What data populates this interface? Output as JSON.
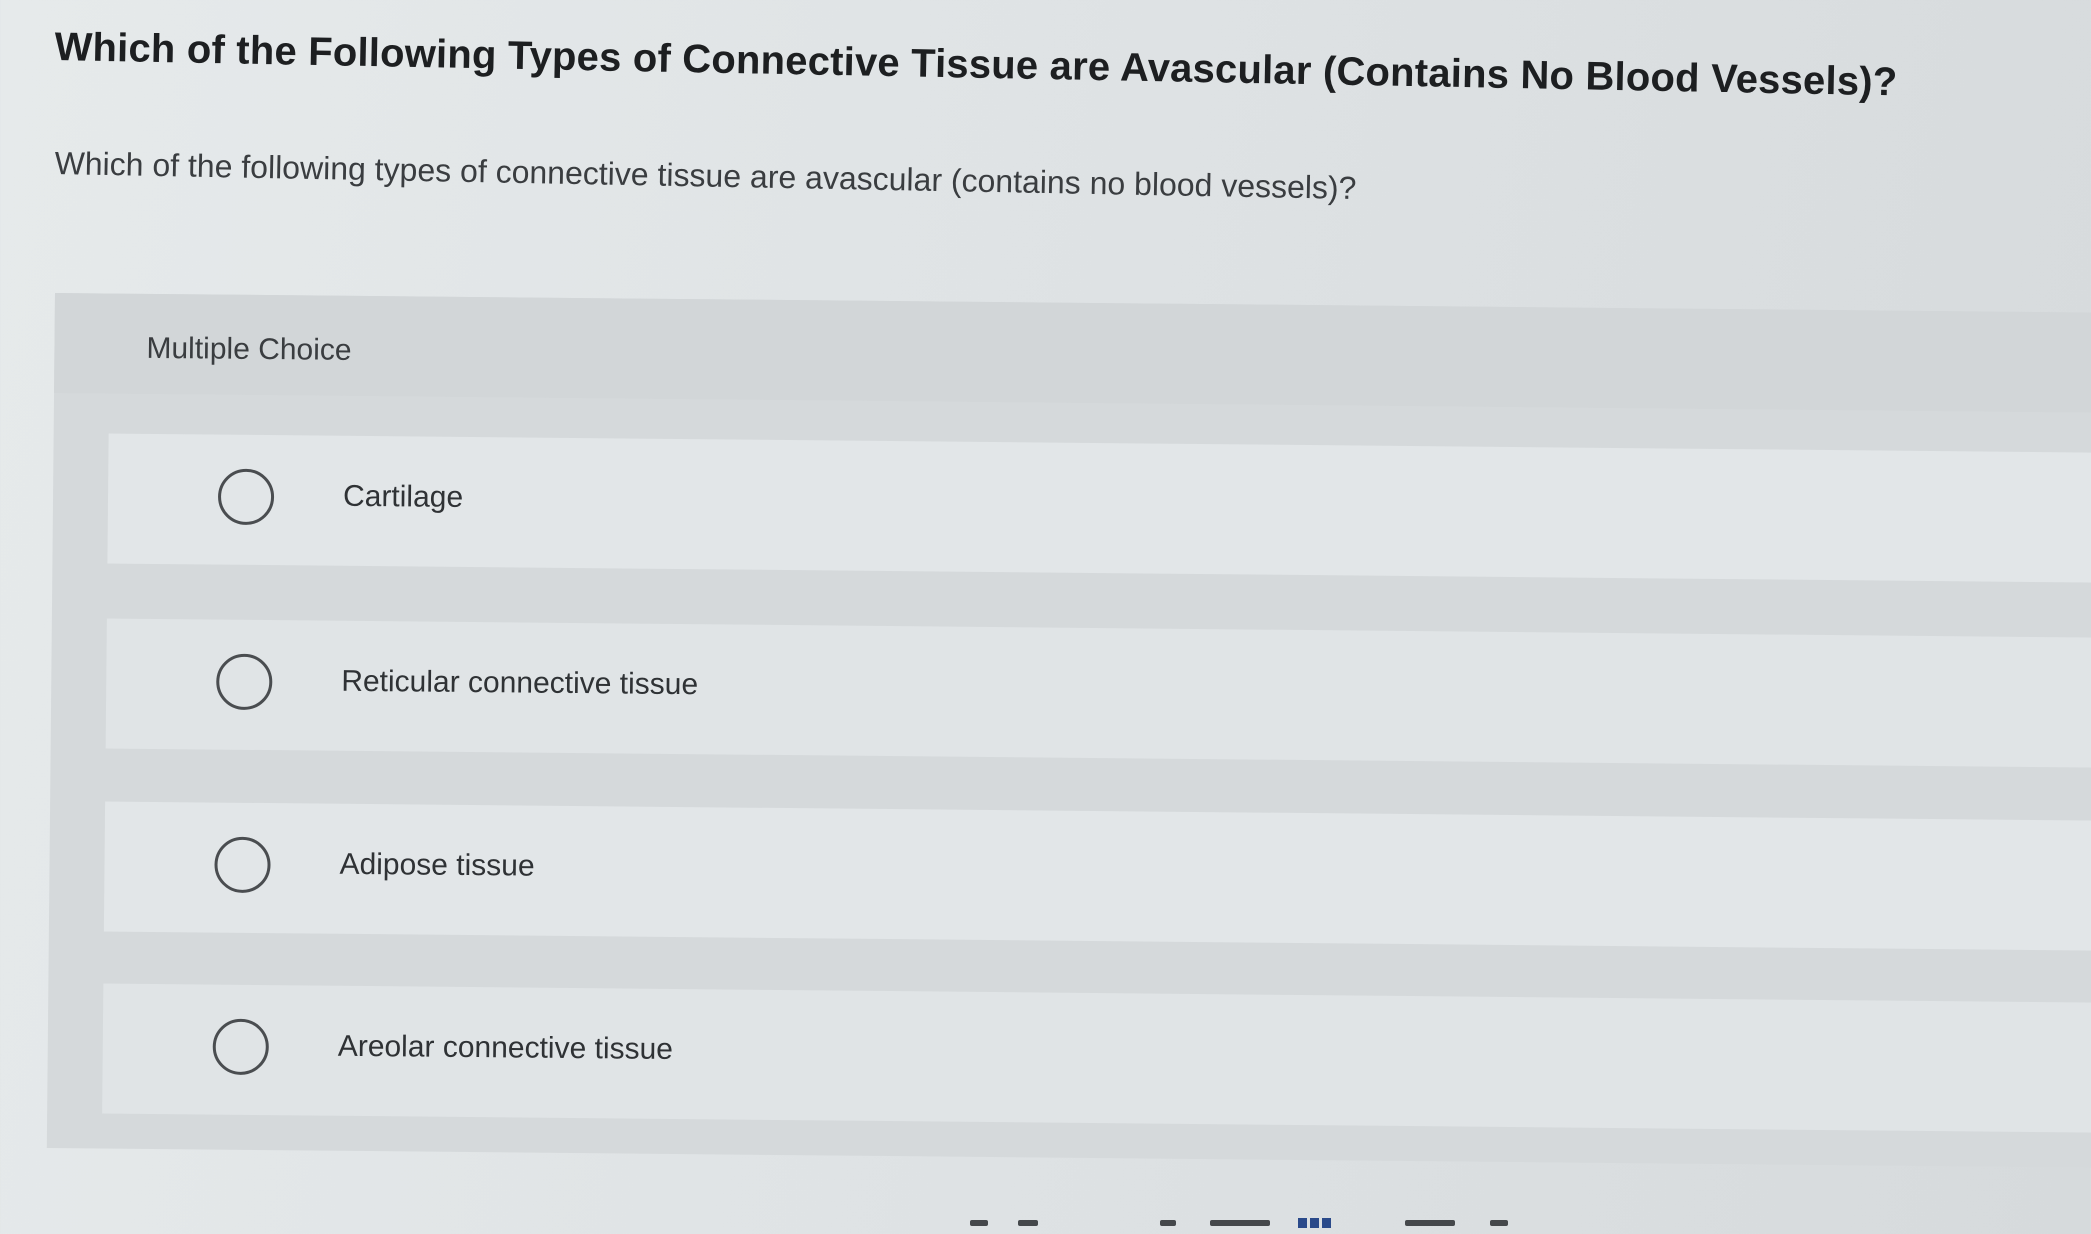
{
  "page": {
    "title": "Which of the Following Types of Connective Tissue are Avascular (Contains No Blood Vessels)?",
    "question": "Which of the following types of connective tissue are avascular (contains no blood vessels)?"
  },
  "multiple_choice": {
    "label": "Multiple Choice",
    "selected": null,
    "options": [
      {
        "label": "Cartilage"
      },
      {
        "label": "Reticular connective tissue"
      },
      {
        "label": "Adipose tissue"
      },
      {
        "label": "Areolar connective tissue"
      }
    ]
  },
  "icons": {
    "radio": "radio-unchecked-icon",
    "grid": "grid-icon"
  },
  "colors": {
    "background": "#e2e6e8",
    "panel": "#d5d9db",
    "text": "#2c2f31",
    "accent": "#2a4a8a"
  }
}
